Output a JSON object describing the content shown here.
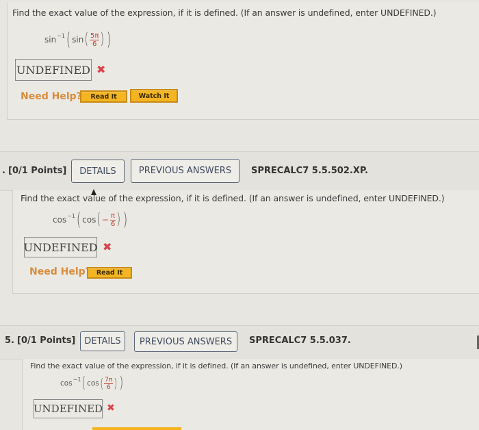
{
  "questions": [
    {
      "prompt": "Find the exact value of the expression, if it is defined. (If an answer is undefined, enter UNDEFINED.)",
      "expression": {
        "outer_fn": "sin",
        "outer_sup": "−1",
        "inner_fn": "sin",
        "sign": "",
        "numerator": "5π",
        "denominator": "6"
      },
      "answer": "UNDEFINED",
      "result_icon": "✖",
      "need_help_label": "Need Help?",
      "help_buttons": [
        "Read It",
        "Watch It"
      ]
    },
    {
      "number": ".",
      "points": "[0/1 Points]",
      "details_label": "DETAILS",
      "previous_answers_label": "PREVIOUS ANSWERS",
      "code": "SPRECALC7 5.5.502.XP.",
      "prompt": "Find the exact value of the expression, if it is defined. (If an answer is undefined, enter UNDEFINED.)",
      "expression": {
        "outer_fn": "cos",
        "outer_sup": "−1",
        "inner_fn": "cos",
        "sign": "−",
        "numerator": "π",
        "denominator": "6"
      },
      "answer": "UNDEFINED",
      "result_icon": "✖",
      "need_help_label": "Need Help?",
      "help_buttons": [
        "Read It"
      ]
    },
    {
      "number": "5.",
      "points": "[0/1 Points]",
      "details_label": "DETAILS",
      "previous_answers_label": "PREVIOUS ANSWERS",
      "code": "SPRECALC7 5.5.037.",
      "prompt": "Find the exact value of the expression, if it is defined. (If an answer is undefined, enter UNDEFINED.)",
      "expression": {
        "outer_fn": "cos",
        "outer_sup": "−1",
        "inner_fn": "cos",
        "sign": "",
        "numerator": "7π",
        "denominator": "6"
      },
      "answer": "UNDEFINED",
      "result_icon": "✖"
    }
  ],
  "colors": {
    "need_help": "#d98b3a",
    "help_button": "#f3b521",
    "wrong_mark": "#d9434b",
    "fraction": "#c0392b"
  }
}
